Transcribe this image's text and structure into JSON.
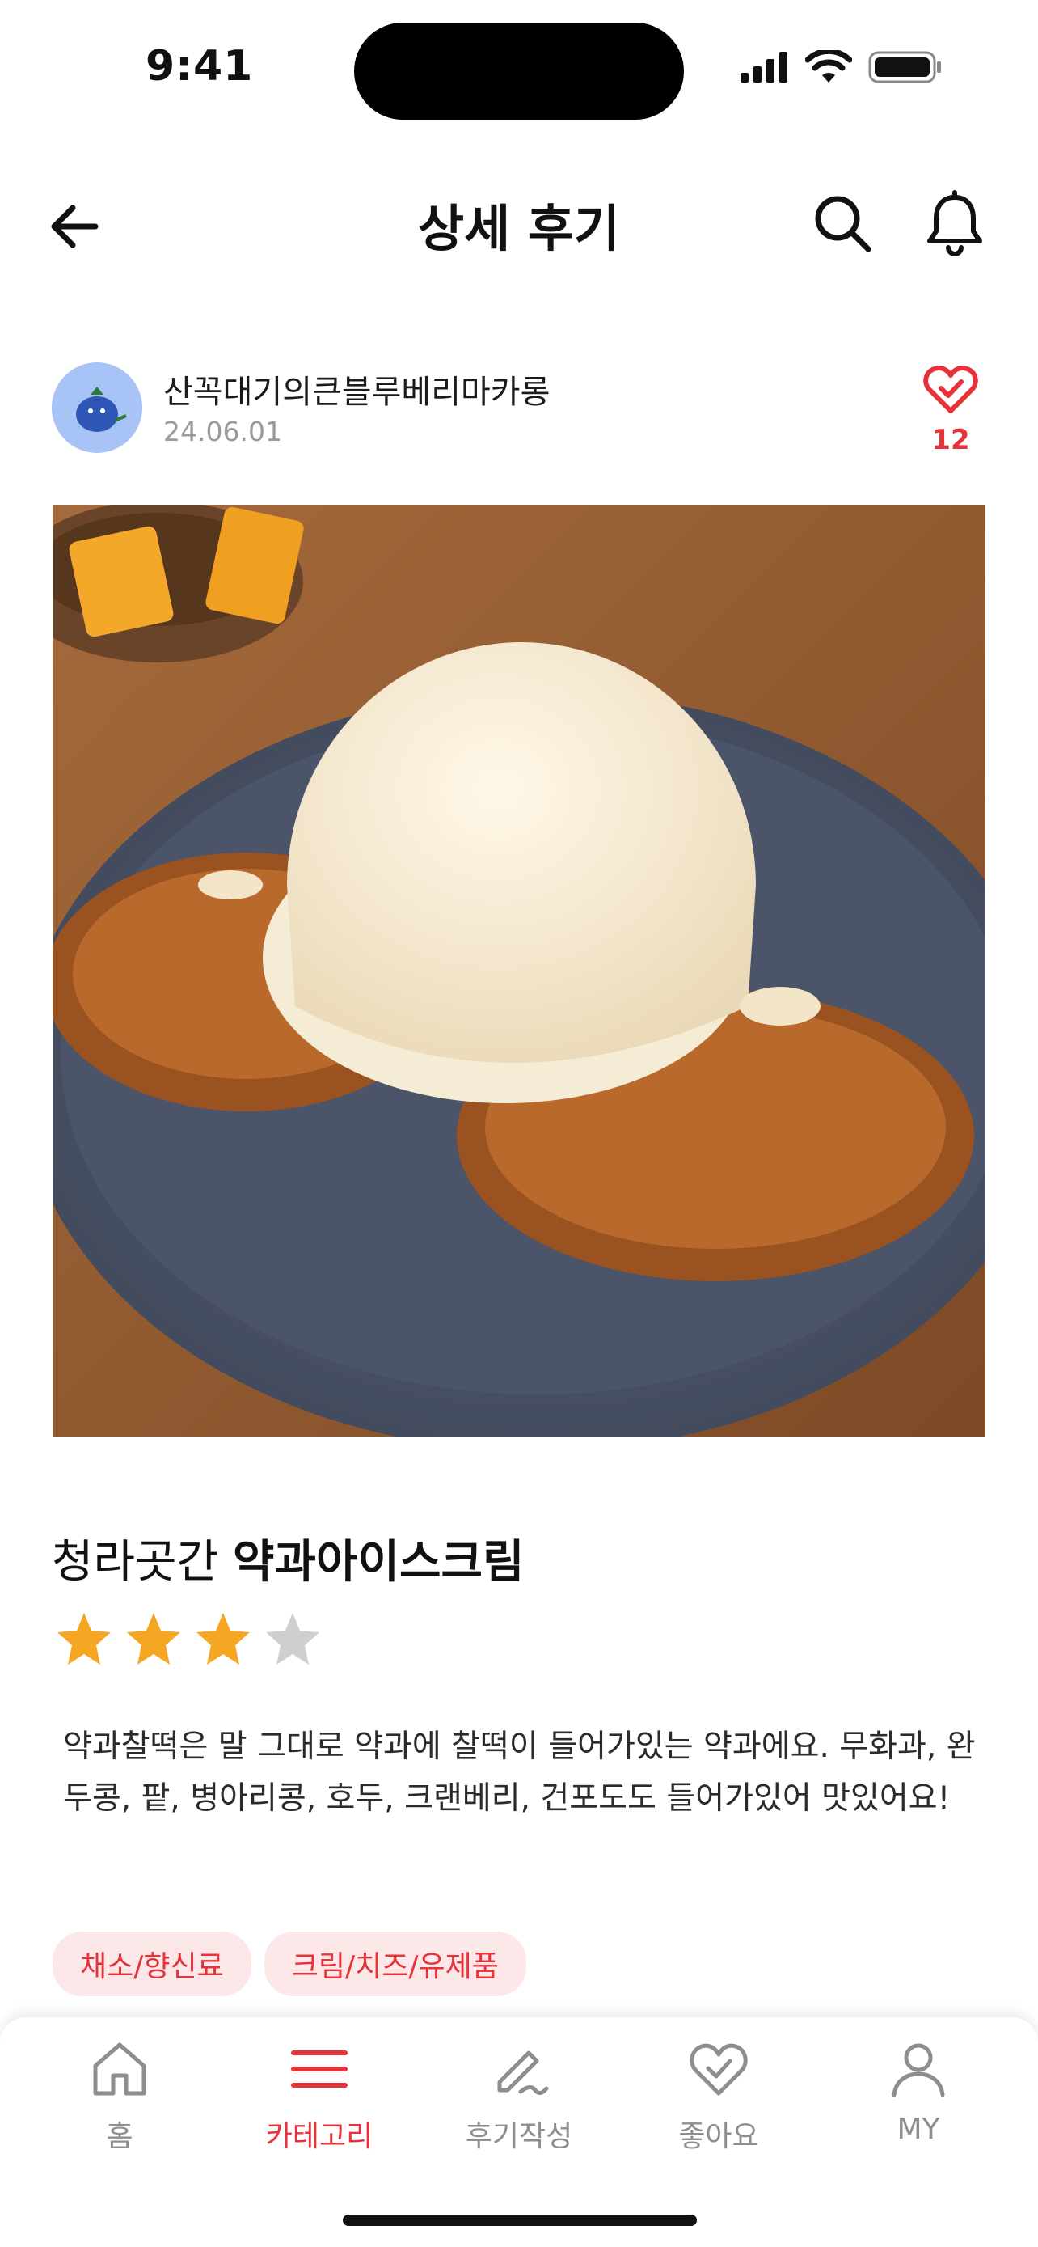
{
  "status_bar": {
    "time": "9:41"
  },
  "header": {
    "title": "상세 후기"
  },
  "author": {
    "name": "산꼭대기의큰블루베리마카롱",
    "date": "24.06.01"
  },
  "likes": {
    "count": "12"
  },
  "review": {
    "store": "청라곳간",
    "menu": "약과아이스크림",
    "rating": 3,
    "rating_max": 4,
    "description": "약과찰떡은 말 그대로 약과에 찰떡이 들어가있는 약과에요. 무화과, 완두콩, 팥, 병아리콩, 호두, 크랜베리, 건포도도 들어가있어 맛있어요!",
    "tags": [
      "채소/향신료",
      "크림/치즈/유제품"
    ]
  },
  "bottom_nav": {
    "items": [
      {
        "label": "홈",
        "icon": "home-icon",
        "active": false
      },
      {
        "label": "카테고리",
        "icon": "menu-icon",
        "active": true
      },
      {
        "label": "후기작성",
        "icon": "pencil-icon",
        "active": false
      },
      {
        "label": "좋아요",
        "icon": "heart-check-icon",
        "active": false
      },
      {
        "label": "MY",
        "icon": "user-icon",
        "active": false
      }
    ]
  },
  "colors": {
    "accent": "#e8323a",
    "star": "#f5a623",
    "star_empty": "#cfcfcf",
    "inactive": "#8e8e8e"
  }
}
